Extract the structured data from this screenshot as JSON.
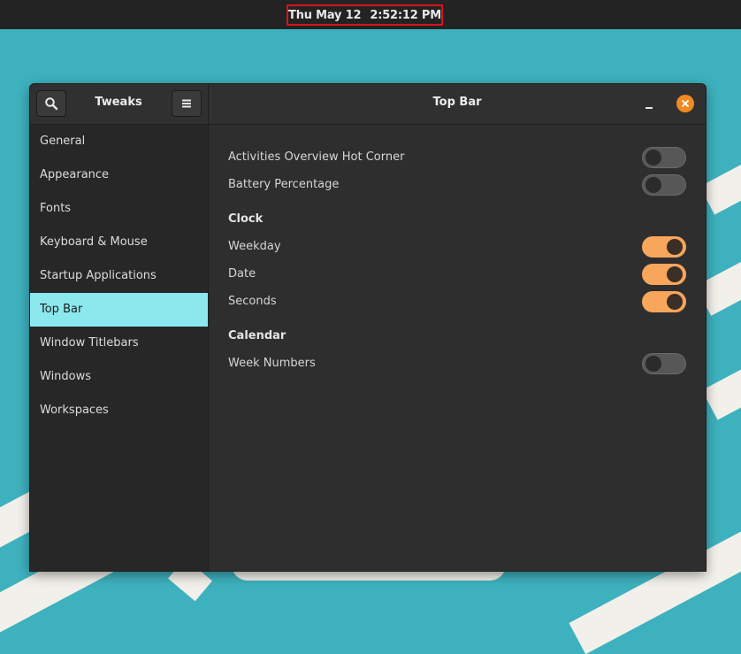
{
  "panel": {
    "clock_day": "Thu May 12",
    "clock_time": "2:52:12 PM"
  },
  "window": {
    "sidebar_title": "Tweaks",
    "main_title": "Top Bar",
    "search_icon": "search-icon",
    "menu_icon": "hamburger-menu-icon",
    "minimize_icon": "minimize-icon",
    "close_icon": "close-icon",
    "accent_color": "#f7a65c",
    "close_color": "#f08a22",
    "selected_color": "#8be9ee"
  },
  "sidebar": {
    "items": [
      {
        "label": "General"
      },
      {
        "label": "Appearance"
      },
      {
        "label": "Fonts"
      },
      {
        "label": "Keyboard & Mouse"
      },
      {
        "label": "Startup Applications"
      },
      {
        "label": "Top Bar",
        "selected": true
      },
      {
        "label": "Window Titlebars"
      },
      {
        "label": "Windows"
      },
      {
        "label": "Workspaces"
      }
    ]
  },
  "settings": {
    "hot_corner": {
      "label": "Activities Overview Hot Corner",
      "enabled": false
    },
    "battery": {
      "label": "Battery Percentage",
      "enabled": false
    },
    "clock_section": "Clock",
    "weekday": {
      "label": "Weekday",
      "enabled": true
    },
    "date": {
      "label": "Date",
      "enabled": true
    },
    "seconds": {
      "label": "Seconds",
      "enabled": true
    },
    "calendar_section": "Calendar",
    "week_numbers": {
      "label": "Week Numbers",
      "enabled": false
    }
  }
}
